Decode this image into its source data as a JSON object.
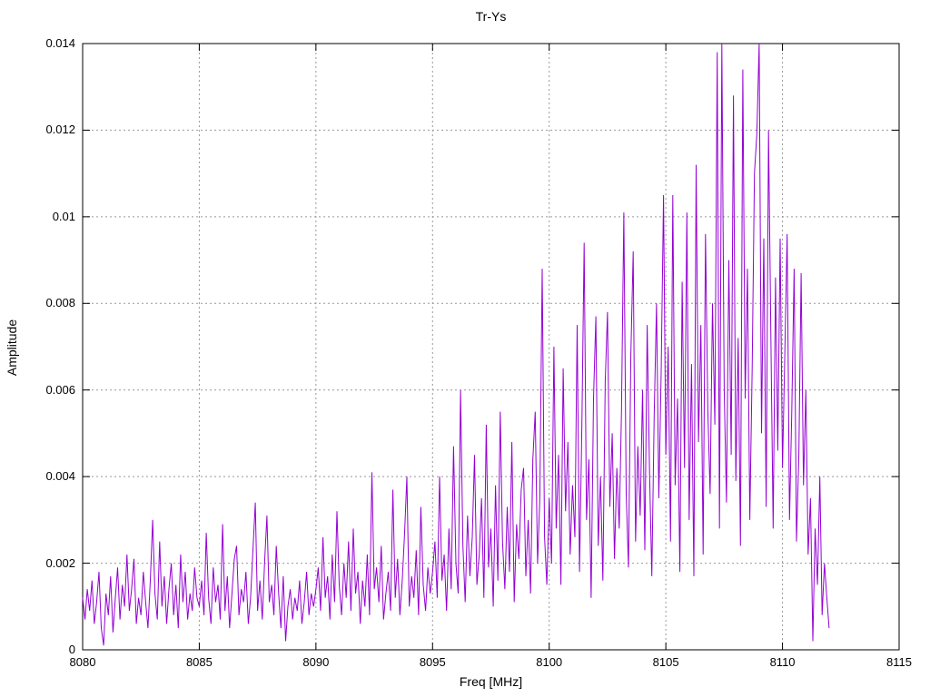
{
  "page": {
    "background": "#ffffff"
  },
  "chart_data": {
    "type": "line",
    "title": "Tr-Ys",
    "xlabel": "Freq [MHz]",
    "ylabel": "Amplitude",
    "xlim": [
      8080,
      8115
    ],
    "ylim": [
      0,
      0.014
    ],
    "x_ticks": [
      8080,
      8085,
      8090,
      8095,
      8100,
      8105,
      8110,
      8115
    ],
    "x_tick_labels": [
      "8080",
      "8085",
      "8090",
      "8095",
      "8100",
      "8105",
      "8110",
      "8115"
    ],
    "y_ticks": [
      0,
      0.002,
      0.004,
      0.006,
      0.008,
      0.01,
      0.012,
      0.014
    ],
    "y_tick_labels": [
      "0",
      "0.002",
      "0.004",
      "0.006",
      "0.008",
      "0.01",
      "0.012",
      "0.014"
    ],
    "grid": true,
    "legend": "none",
    "line_color": "#9400d3",
    "grid_color": "#999999",
    "axis_color": "#000000",
    "series": [
      {
        "name": "Tr-Ys",
        "x_start": 8080.0,
        "x_step": 0.1,
        "y_unit": 0.0001,
        "y": [
          12,
          7,
          14,
          9,
          16,
          6,
          11,
          18,
          5,
          1,
          13,
          8,
          17,
          4,
          12,
          19,
          7,
          15,
          10,
          22,
          9,
          14,
          21,
          6,
          12,
          8,
          18,
          11,
          5,
          16,
          30,
          13,
          7,
          25,
          10,
          17,
          6,
          14,
          20,
          8,
          15,
          5,
          22,
          11,
          18,
          7,
          13,
          9,
          19,
          12,
          10,
          16,
          8,
          27,
          12,
          6,
          19,
          11,
          15,
          7,
          29,
          9,
          17,
          5,
          13,
          21,
          24,
          8,
          14,
          11,
          18,
          6,
          12,
          23,
          34,
          9,
          16,
          7,
          20,
          31,
          11,
          15,
          8,
          24,
          13,
          5,
          17,
          2,
          10,
          14,
          7,
          12,
          9,
          16,
          6,
          11,
          18,
          8,
          13,
          10,
          14,
          19,
          9,
          26,
          12,
          17,
          7,
          22,
          11,
          32,
          15,
          8,
          20,
          12,
          25,
          9,
          28,
          13,
          18,
          6,
          16,
          10,
          22,
          8,
          41,
          14,
          19,
          11,
          24,
          7,
          13,
          18,
          9,
          37,
          12,
          21,
          8,
          16,
          27,
          40,
          10,
          17,
          12,
          23,
          8,
          33,
          15,
          9,
          19,
          13,
          18,
          25,
          12,
          40,
          16,
          22,
          9,
          28,
          14,
          47,
          20,
          13,
          60,
          24,
          11,
          31,
          17,
          26,
          45,
          15,
          22,
          35,
          12,
          52,
          19,
          28,
          10,
          38,
          16,
          55,
          25,
          14,
          33,
          18,
          48,
          11,
          29,
          21,
          37,
          42,
          17,
          30,
          13,
          44,
          55,
          20,
          35,
          88,
          26,
          15,
          35,
          20,
          70,
          28,
          45,
          15,
          65,
          32,
          48,
          22,
          38,
          26,
          75,
          18,
          52,
          94,
          30,
          44,
          12,
          58,
          77,
          24,
          40,
          16,
          62,
          78,
          33,
          50,
          21,
          42,
          28,
          55,
          101,
          36,
          19,
          68,
          92,
          25,
          47,
          31,
          60,
          23,
          75,
          41,
          17,
          54,
          80,
          35,
          64,
          105,
          45,
          70,
          25,
          105,
          38,
          58,
          18,
          85,
          42,
          101,
          30,
          66,
          17,
          112,
          48,
          75,
          22,
          96,
          55,
          36,
          80,
          52,
          138,
          28,
          140,
          60,
          34,
          90,
          45,
          128,
          39,
          72,
          24,
          134,
          58,
          88,
          30,
          65,
          110,
          119,
          140,
          50,
          95,
          33,
          120,
          74,
          28,
          86,
          46,
          95,
          42,
          68,
          96,
          30,
          55,
          88,
          25,
          45,
          87,
          38,
          60,
          22,
          35,
          2,
          28,
          15,
          40,
          8,
          20,
          12,
          5
        ]
      }
    ]
  }
}
